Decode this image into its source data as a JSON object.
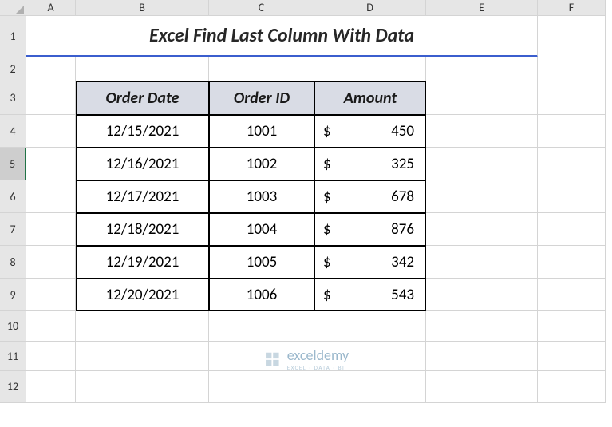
{
  "columns": [
    "A",
    "B",
    "C",
    "D",
    "E",
    "F"
  ],
  "rows": [
    "1",
    "2",
    "3",
    "4",
    "5",
    "6",
    "7",
    "8",
    "9",
    "10",
    "11",
    "12"
  ],
  "selected_row": "5",
  "title": "Excel Find Last Column With Data",
  "table": {
    "headers": [
      "Order Date",
      "Order ID",
      "Amount"
    ],
    "data": [
      {
        "date": "12/15/2021",
        "id": "1001",
        "currency": "$",
        "amount": "450"
      },
      {
        "date": "12/16/2021",
        "id": "1002",
        "currency": "$",
        "amount": "325"
      },
      {
        "date": "12/17/2021",
        "id": "1003",
        "currency": "$",
        "amount": "678"
      },
      {
        "date": "12/18/2021",
        "id": "1004",
        "currency": "$",
        "amount": "876"
      },
      {
        "date": "12/19/2021",
        "id": "1005",
        "currency": "$",
        "amount": "342"
      },
      {
        "date": "12/20/2021",
        "id": "1006",
        "currency": "$",
        "amount": "543"
      }
    ]
  },
  "watermark": {
    "name": "exceldemy",
    "tagline": "EXCEL · DATA · BI"
  }
}
